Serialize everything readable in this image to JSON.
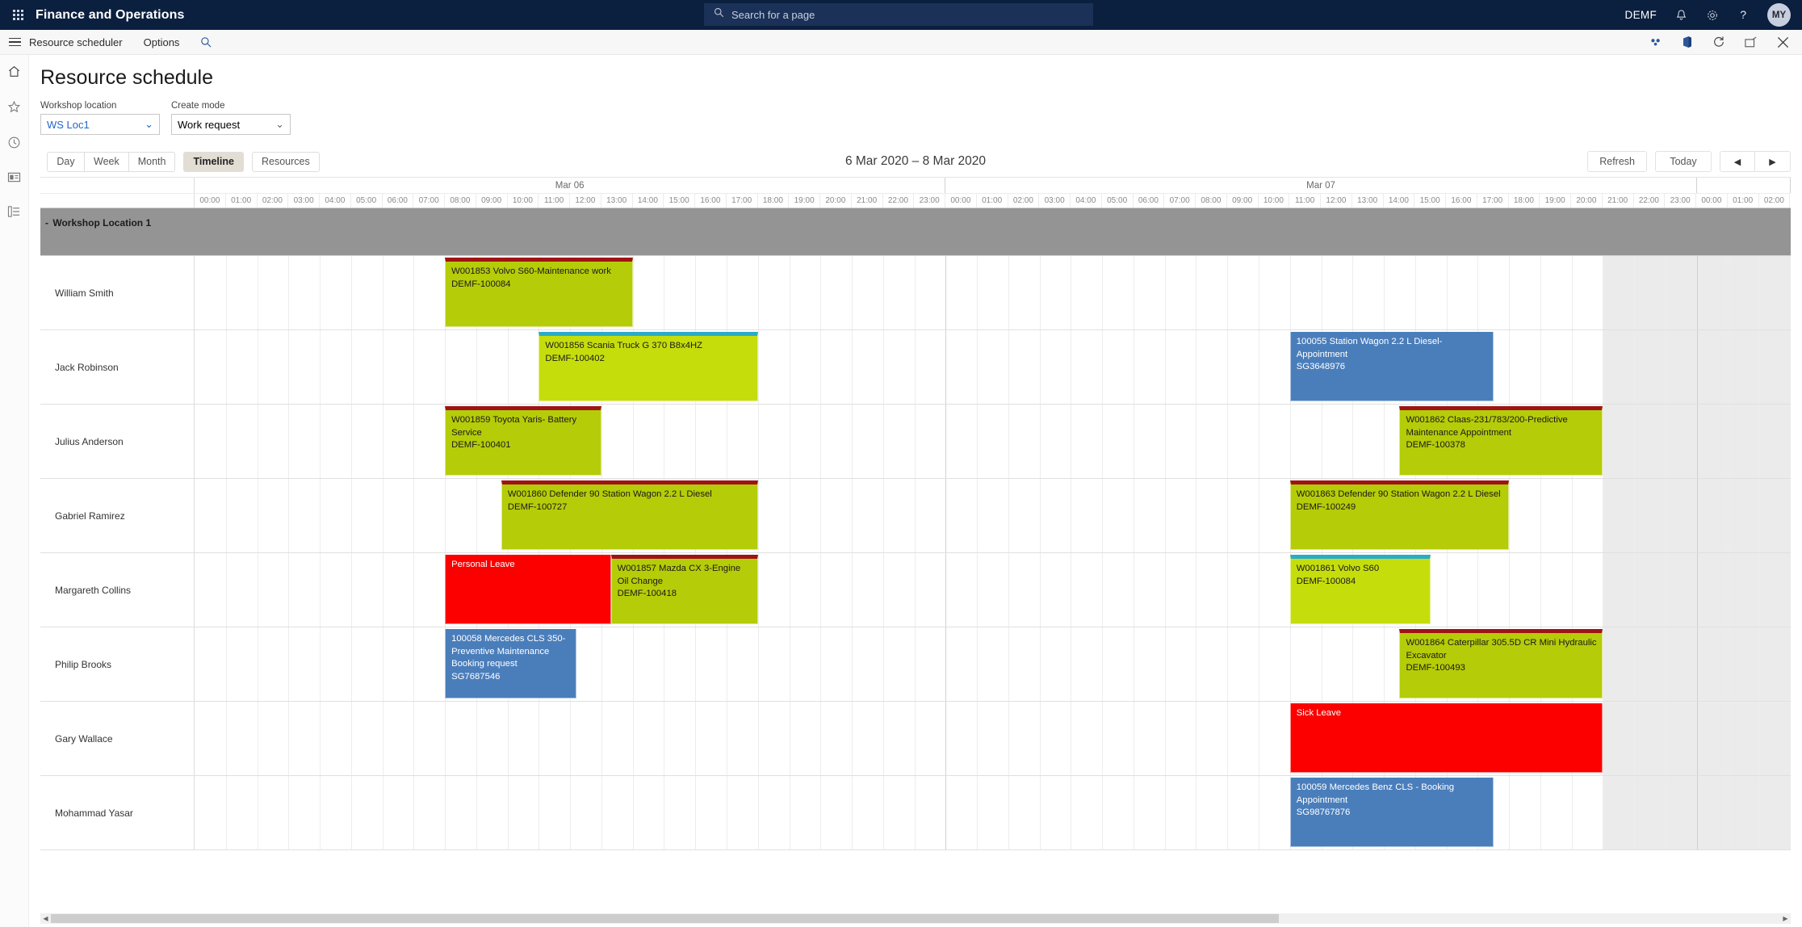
{
  "topbar": {
    "app_title": "Finance and Operations",
    "search_placeholder": "Search for a page",
    "search_value": "",
    "company": "DEMF",
    "avatar_initials": "MY",
    "waffle_icon": "waffle-grid-icon",
    "search_icon": "search-icon",
    "bell_icon": "notification-bell-icon",
    "gear_icon": "settings-gear-icon",
    "help_icon": "help-question-icon"
  },
  "commandbar": {
    "menu_icon": "hamburger-menu-icon",
    "items": [
      {
        "label": "Resource scheduler"
      },
      {
        "label": "Options"
      }
    ],
    "search_icon": "search-icon",
    "right_icons": [
      {
        "name": "link-share-icon"
      },
      {
        "name": "office-app-icon"
      },
      {
        "name": "refresh-circle-icon"
      },
      {
        "name": "popout-window-icon"
      },
      {
        "name": "close-icon"
      }
    ]
  },
  "leftrail": {
    "items": [
      {
        "name": "home-icon"
      },
      {
        "name": "favorites-star-icon"
      },
      {
        "name": "recent-clock-icon"
      },
      {
        "name": "workspaces-icon"
      },
      {
        "name": "modules-list-icon"
      }
    ]
  },
  "page": {
    "title": "Resource schedule"
  },
  "filters": [
    {
      "label": "Workshop location",
      "value": "WS Loc1",
      "accent": true
    },
    {
      "label": "Create mode",
      "value": "Work request",
      "accent": false
    }
  ],
  "toolbar": {
    "views": [
      {
        "label": "Day",
        "active": false
      },
      {
        "label": "Week",
        "active": false
      },
      {
        "label": "Month",
        "active": false
      }
    ],
    "timeline_label": "Timeline",
    "timeline_active": true,
    "resources_label": "Resources",
    "range_title": "6 Mar 2020 – 8 Mar 2020",
    "refresh_label": "Refresh",
    "today_label": "Today",
    "prev_label": "◀",
    "next_label": "▶"
  },
  "timeline": {
    "days": [
      {
        "label": "Mar 06",
        "hours": [
          "00:00",
          "01:00",
          "02:00",
          "03:00",
          "04:00",
          "05:00",
          "06:00",
          "07:00",
          "08:00",
          "09:00",
          "10:00",
          "11:00",
          "12:00",
          "13:00",
          "14:00",
          "15:00",
          "16:00",
          "17:00",
          "18:00",
          "19:00",
          "20:00",
          "21:00",
          "22:00",
          "23:00"
        ]
      },
      {
        "label": "Mar 07",
        "hours": [
          "00:00",
          "01:00",
          "02:00",
          "03:00",
          "04:00",
          "05:00",
          "06:00",
          "07:00",
          "08:00",
          "09:00",
          "10:00",
          "11:00",
          "12:00",
          "13:00",
          "14:00",
          "15:00",
          "16:00",
          "17:00",
          "18:00",
          "19:00",
          "20:00",
          "21:00",
          "22:00",
          "23:00"
        ]
      },
      {
        "label": "",
        "hours": [
          "00:00",
          "01:00",
          "02:00"
        ]
      }
    ],
    "group": {
      "label": "Workshop Location 1",
      "toggle": "-"
    }
  },
  "colors": {
    "work_request": "#b5cc08",
    "work_request_accent": "#9e1414",
    "work_request_alt": "#c6dd0c",
    "work_request_alt_accent": "#2aacc8",
    "appointment": "#4a7ebb",
    "leave": "#fc0000",
    "group_header": "#949494",
    "brand_navy": "#0b1f3f",
    "active_button": "#e3ded4"
  },
  "rows": [
    {
      "resource": "William Smith",
      "events": [
        {
          "kind": "work",
          "start": 8.0,
          "end": 14.0,
          "lines": [
            "W001853 Volvo S60-Maintenance work",
            "DEMF-100084"
          ]
        }
      ]
    },
    {
      "resource": "Jack Robinson",
      "events": [
        {
          "kind": "workb",
          "start": 11.0,
          "end": 18.0,
          "lines": [
            "W001856 Scania Truck G 370 B8x4HZ",
            "DEMF-100402"
          ]
        },
        {
          "kind": "appt",
          "start": 35.0,
          "end": 41.5,
          "lines": [
            "100055 Station Wagon 2.2 L Diesel- Appointment",
            "SG3648976"
          ]
        }
      ]
    },
    {
      "resource": "Julius Anderson",
      "events": [
        {
          "kind": "work",
          "start": 8.0,
          "end": 13.0,
          "lines": [
            "W001859 Toyota Yaris- Battery Service",
            "DEMF-100401"
          ]
        },
        {
          "kind": "work",
          "start": 38.5,
          "end": 45.0,
          "lines": [
            "W001862 Claas-231/783/200-Predictive Maintenance Appointment",
            "DEMF-100378"
          ]
        }
      ]
    },
    {
      "resource": "Gabriel Ramirez",
      "events": [
        {
          "kind": "work",
          "start": 9.8,
          "end": 18.0,
          "lines": [
            "W001860 Defender 90 Station Wagon 2.2 L Diesel",
            "DEMF-100727"
          ]
        },
        {
          "kind": "work",
          "start": 35.0,
          "end": 42.0,
          "lines": [
            "W001863 Defender 90 Station Wagon 2.2 L Diesel",
            "DEMF-100249"
          ]
        }
      ]
    },
    {
      "resource": "Margareth Collins",
      "events": [
        {
          "kind": "leave",
          "start": 8.0,
          "end": 13.3,
          "lines": [
            "Personal Leave"
          ]
        },
        {
          "kind": "work",
          "start": 13.3,
          "end": 18.0,
          "lines": [
            "W001857 Mazda CX 3-Engine Oil Change",
            "DEMF-100418"
          ]
        },
        {
          "kind": "workb",
          "start": 35.0,
          "end": 39.5,
          "lines": [
            "W001861 Volvo S60",
            "DEMF-100084"
          ]
        }
      ]
    },
    {
      "resource": "Philip Brooks",
      "events": [
        {
          "kind": "appt",
          "start": 8.0,
          "end": 12.2,
          "lines": [
            "100058 Mercedes CLS 350-Preventive Maintenance Booking request",
            "SG7687546"
          ]
        },
        {
          "kind": "work",
          "start": 38.5,
          "end": 45.0,
          "lines": [
            "W001864 Caterpillar 305.5D CR Mini Hydraulic Excavator",
            "DEMF-100493"
          ]
        }
      ]
    },
    {
      "resource": "Gary Wallace",
      "events": [
        {
          "kind": "leave",
          "start": 35.0,
          "end": 45.0,
          "lines": [
            "Sick Leave"
          ]
        }
      ]
    },
    {
      "resource": "Mohammad Yasar",
      "events": [
        {
          "kind": "appt",
          "start": 35.0,
          "end": 41.5,
          "lines": [
            "100059 Mercedes Benz CLS - Booking Appointment",
            "SG98767876"
          ]
        }
      ]
    }
  ],
  "scrollbar": {
    "left_arrow": "◀",
    "right_arrow": "▶"
  }
}
